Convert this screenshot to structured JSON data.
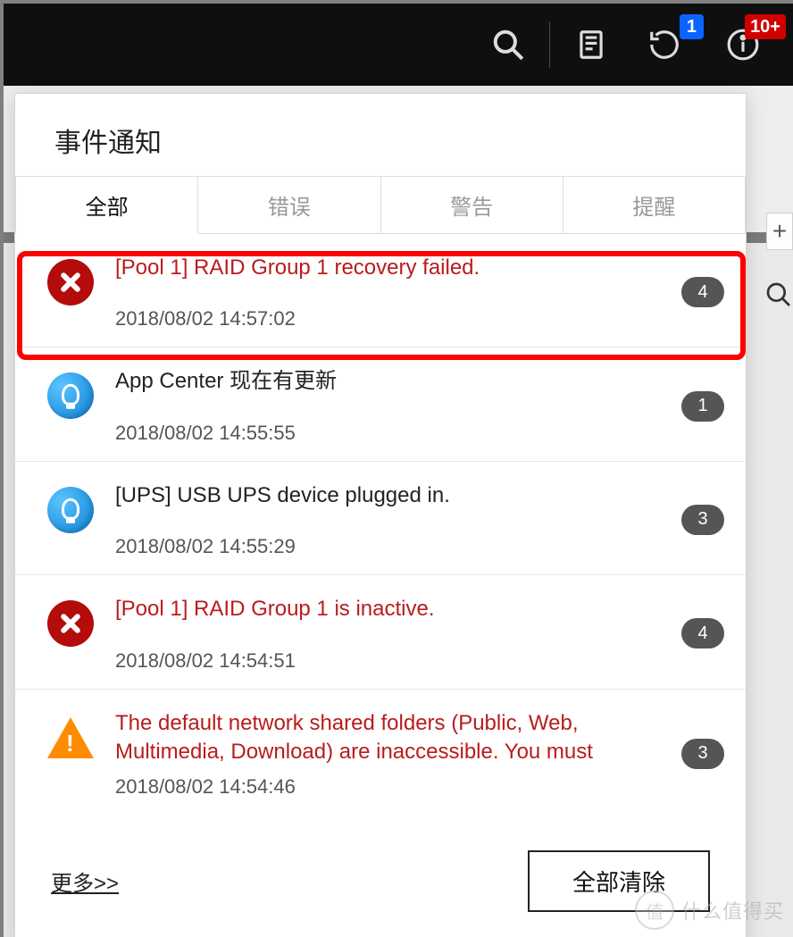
{
  "topbar": {
    "search_icon": "search",
    "notes_icon": "notes",
    "refresh_icon": "refresh",
    "refresh_badge": "1",
    "info_icon": "info",
    "info_badge": "10+"
  },
  "panel": {
    "title": "事件通知",
    "tabs": [
      {
        "label": "全部",
        "active": true
      },
      {
        "label": "错误",
        "active": false
      },
      {
        "label": "警告",
        "active": false
      },
      {
        "label": "提醒",
        "active": false
      }
    ],
    "items": [
      {
        "type": "error",
        "message": "[Pool 1] RAID Group 1 recovery failed.",
        "timestamp": "2018/08/02 14:57:02",
        "count": "4",
        "highlighted": true
      },
      {
        "type": "info",
        "message": "App Center 现在有更新",
        "timestamp": "2018/08/02 14:55:55",
        "count": "1",
        "highlighted": false
      },
      {
        "type": "info",
        "message": "[UPS] USB UPS device plugged in.",
        "timestamp": "2018/08/02 14:55:29",
        "count": "3",
        "highlighted": false
      },
      {
        "type": "error",
        "message": "[Pool 1] RAID Group 1 is inactive.",
        "timestamp": "2018/08/02 14:54:51",
        "count": "4",
        "highlighted": false
      },
      {
        "type": "warn",
        "message": "The default network shared folders (Public, Web, Multimedia, Download) are inaccessible. You must",
        "timestamp": "2018/08/02 14:54:46",
        "count": "3",
        "highlighted": false
      }
    ],
    "more_label": "更多>>",
    "clear_label": "全部清除"
  },
  "plus_label": "+",
  "watermark": {
    "symbol": "值",
    "text": "什么值得买"
  }
}
